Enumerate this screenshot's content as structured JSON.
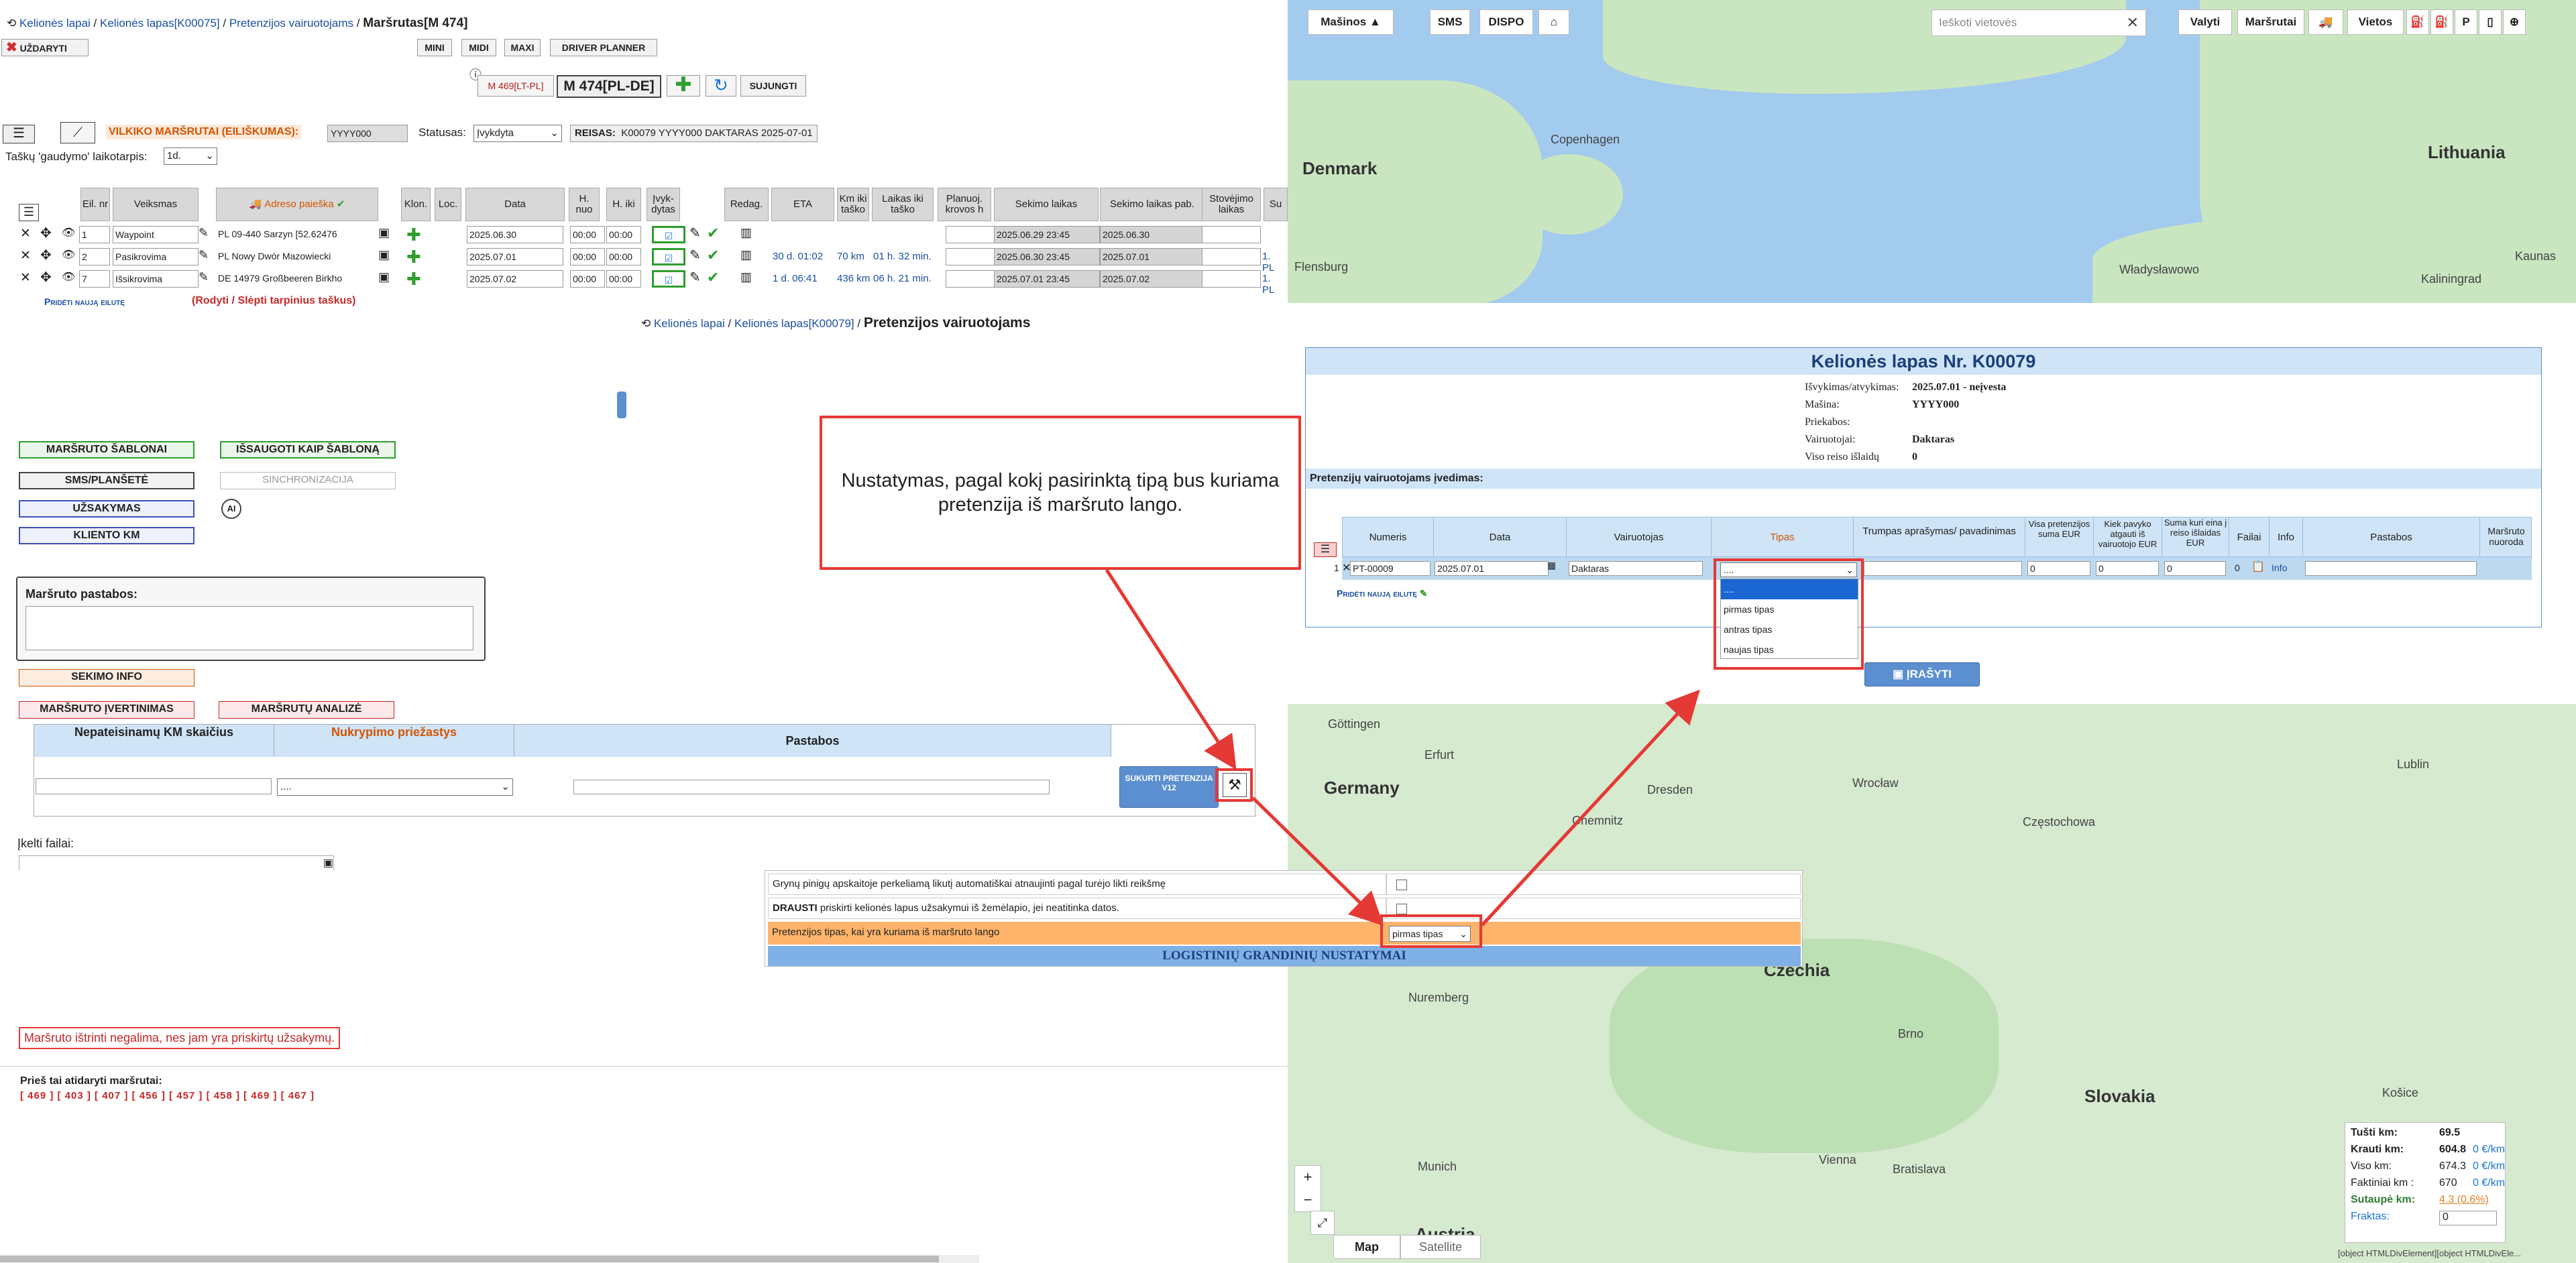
{
  "left": {
    "breadcrumb": [
      "Kelionės lapai",
      "Kelionės lapas[K00075]",
      "Pretenzijos vairuotojams"
    ],
    "title": "Maršrutas[M 474]",
    "close_label": "UŽDARYTI",
    "view_buttons": [
      "MINI",
      "MIDI",
      "MAXI",
      "DRIVER PLANNER"
    ],
    "route_tag": "M 469[LT-PL]",
    "route_main": "M 474[PL-DE]",
    "join_label": "SUJUNGTI",
    "vilkiko_label": "VILKIKO MARŠRUTAI (EILIŠKUMAS):",
    "vilkiko_value": "YYYY000",
    "status_label": "Statusas:",
    "status_value": "Įvykdyta",
    "reisas_label": "REISAS:",
    "reisas_value": "K00079 YYYY000 DAKTARAS 2025-07-01",
    "taskas_label": "Taškų 'gaudymo' laikotarpis:",
    "taskas_value": "1d.",
    "table_headers": [
      "Eil. nr",
      "Veiksmas",
      "Adreso paieška",
      "Klon.",
      "Loc.",
      "Data",
      "H. nuo",
      "H. iki",
      "Įvyk-dytas",
      "Redag.",
      "ETA",
      "Km iki taško",
      "Laikas iki taško",
      "Planuoj. krovos h",
      "Sekimo laikas",
      "Sekimo laikas pab.",
      "Stovėjimo laikas",
      "Su"
    ],
    "rows": [
      {
        "nr": "1",
        "action": "Waypoint",
        "address": "PL 09-440 Sarzyn  [52.62476",
        "date": "2025.06.30",
        "hfrom": "00:00",
        "hto": "00:00",
        "eta": "",
        "km": "",
        "time": "",
        "track": "2025.06.29 23:45",
        "trackend": "2025.06.30",
        "extra": ""
      },
      {
        "nr": "2",
        "action": "Pasikrovima",
        "address": "PL   Nowy Dwór Mazowiecki",
        "date": "2025.07.01",
        "hfrom": "00:00",
        "hto": "00:00",
        "eta": "30 d. 01:02",
        "km": "70 km",
        "time": "01 h. 32 min.",
        "track": "2025.06.30 23:45",
        "trackend": "2025.07.01",
        "extra": "1. PL"
      },
      {
        "nr": "7",
        "action": "Išsikrovima",
        "address": "DE 14979 Großbeeren Birkho",
        "date": "2025.07.02",
        "hfrom": "00:00",
        "hto": "00:00",
        "eta": "1 d. 06:41",
        "km": "436 km",
        "time": "06 h. 21 min.",
        "track": "2025.07.01 23:45",
        "trackend": "2025.07.02",
        "extra": "1. PL"
      }
    ],
    "add_row": "Pridėti naują eilutę",
    "show_hide": "(Rodyti / Slėpti tarpinius taškus)",
    "btn_template": "MARŠRUTO ŠABLONAI",
    "btn_save_template": "IŠSAUGOTI KAIP ŠABLONĄ",
    "btn_sms": "SMS/PLANŠETĖ",
    "btn_sync": "SINCHRONIZACIJA",
    "btn_orders": "UŽSAKYMAS",
    "btn_client": "KLIENTO KM",
    "notes_label": "Maršruto pastabos:",
    "btn_track_info": "SEKIMO INFO",
    "btn_eval": "MARŠRUTO ĮVERTINIMAS",
    "btn_analysis": "MARŠRUTŲ ANALIZĖ",
    "km_headers": [
      "Nepateisinamų KM skaičius",
      "Nukrypimo priežastys",
      "Pastabos"
    ],
    "km_select": "....",
    "btn_create_claim": "SUKURTI PRETENZIJA V12",
    "files_label": "Įkelti failai:",
    "error_msg": "Maršruto ištrinti negalima, nes jam yra priskirtų užsakymų.",
    "prev_label": "Prieš tai atidaryti maršrutai:",
    "prev_routes": "[ 469 ]  [ 403 ]  [ 407 ]  [ 456 ]  [ 457 ]  [ 458 ]  [ 469 ]  [ 467 ]"
  },
  "map": {
    "toolbar": [
      "Mašinos ▲",
      "SMS",
      "DISPO"
    ],
    "search_placeholder": "Ieškoti vietovės",
    "right_buttons": [
      "Valyti",
      "Maršrutai",
      "Vietos"
    ],
    "labels": {
      "denmark": "Denmark",
      "copenhagen": "Copenhagen",
      "lithuania": "Lithuania",
      "kaunas": "Kaunas",
      "germany": "Germany",
      "czechia": "Czechia",
      "slovakia": "Slovakia",
      "austria": "Austria",
      "lublin": "Lublin",
      "wroclaw": "Wrocław",
      "dresden": "Dresden",
      "vienna": "Vienna",
      "munich": "Munich",
      "nuremberg": "Nuremberg",
      "brno": "Brno",
      "erfurt": "Erfurt",
      "kosice": "Košice",
      "bratislava": "Bratislava",
      "czestochowa": "Częstochowa",
      "chemnitz": "Chemnitz",
      "flensburg": "Flensburg",
      "kaliningrad": "Kaliningrad",
      "wladyslawowo": "Władysławowo",
      "gottingen": "Göttingen"
    },
    "map_btn": "Map",
    "sat_btn": "Satellite",
    "stats": [
      {
        "label": "Tušti km:",
        "value": "69.5",
        "extra": ""
      },
      {
        "label": "Krauti km:",
        "value": "604.8",
        "extra": "0 €/km"
      },
      {
        "label": "Viso km:",
        "value": "674.3",
        "extra": "0 €/km"
      },
      {
        "label": "Faktiniai km :",
        "value": "670",
        "extra": "0 €/km"
      },
      {
        "label": "Sutaupė km:",
        "value": "4.3 (0.6%)",
        "extra": ""
      },
      {
        "label": "Fraktas:",
        "value": "0",
        "extra": ""
      }
    ],
    "footer": "[object HTMLDivElement][object HTMLDivEle..."
  },
  "claims_page": {
    "breadcrumb": [
      "Kelionės lapai",
      "Kelionės lapas[K00079]"
    ],
    "title": "Pretenzijos vairuotojams",
    "header": "Kelionės lapas Nr. K00079",
    "info": [
      {
        "label": "Išvykimas/atvykimas:",
        "value": "2025.07.01 - neįvesta"
      },
      {
        "label": "Mašina:",
        "value": "YYYY000"
      },
      {
        "label": "Priekabos:",
        "value": ""
      },
      {
        "label": "Vairuotojai:",
        "value": "Daktaras"
      },
      {
        "label": "Viso reiso išlaidų",
        "value": "0"
      }
    ],
    "section": "Pretenzijų vairuotojams įvedimas:",
    "col_headers": [
      "Numeris",
      "Data",
      "Vairuotojas",
      "Tipas",
      "Trumpas aprašymas/ pavadinimas",
      "Visa pretenzijos suma EUR",
      "Kiek pavyko atgauti iš vairuotojo EUR",
      "Suma kuri eina į reiso išlaidas EUR",
      "Failai",
      "Info",
      "Pastabos",
      "Maršruto nuoroda"
    ],
    "row": {
      "nr": "1",
      "number": "PT-00009",
      "date": "2025.07.01",
      "driver": "Daktaras",
      "type": "....",
      "sum1": "0",
      "sum2": "0",
      "sum3": "0",
      "files": "0",
      "info": "Info"
    },
    "dropdown_options": [
      "....",
      "pirmas tipas",
      "antras tipas",
      "naujas tipas"
    ],
    "add_row": "Pridėti naują eilutę",
    "save": "ĮRAŠYTI"
  },
  "settings": {
    "row1": "Grynų pinigų apskaitoje perkeliamą likutį automatiškai atnaujinti pagal turėjo likti reikšmę",
    "row2_bold": "DRAUSTI",
    "row2": " priskirti kelionės lapus užsakymui iš žemėlapio, jei neatitinka datos.",
    "row3": "Pretenzijos tipas, kai yra kuriama iš maršruto lango",
    "row3_value": "pirmas tipas",
    "row4": "LOGISTINIŲ GRANDINIŲ NUSTATYMAI"
  },
  "callout": "Nustatymas, pagal kokį pasirinktą tipą bus kuriama pretenzija iš maršruto lango."
}
